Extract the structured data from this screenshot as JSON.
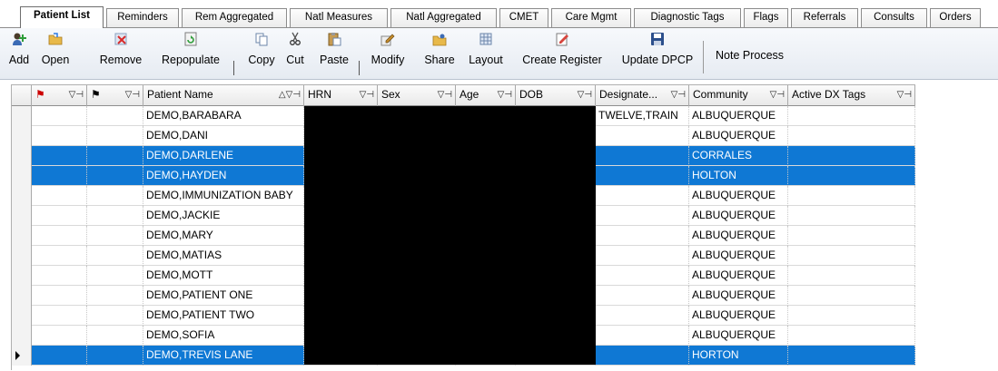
{
  "tabs": [
    {
      "label": "Patient List",
      "active": true
    },
    {
      "label": "Reminders",
      "active": false
    },
    {
      "label": "Rem Aggregated",
      "active": false
    },
    {
      "label": "Natl Measures",
      "active": false
    },
    {
      "label": "Natl Aggregated",
      "active": false
    },
    {
      "label": "CMET",
      "active": false
    },
    {
      "label": "Care Mgmt",
      "active": false
    },
    {
      "label": "Diagnostic Tags",
      "active": false
    },
    {
      "label": "Flags",
      "active": false
    },
    {
      "label": "Referrals",
      "active": false
    },
    {
      "label": "Consults",
      "active": false
    },
    {
      "label": "Orders",
      "active": false
    }
  ],
  "toolbar": {
    "add": "Add",
    "open": "Open",
    "remove": "Remove",
    "repopulate": "Repopulate",
    "copy": "Copy",
    "cut": "Cut",
    "paste": "Paste",
    "modify": "Modify",
    "share": "Share",
    "layout": "Layout",
    "create_register": "Create Register",
    "update_dpcp": "Update DPCP",
    "note_process": "Note Process"
  },
  "grid": {
    "columns": {
      "patient_name": "Patient Name",
      "hrn": "HRN",
      "sex": "Sex",
      "age": "Age",
      "dob": "DOB",
      "designated": "Designate...",
      "community": "Community",
      "active_dx_tags": "Active DX Tags"
    },
    "rows": [
      {
        "name": "DEMO,BARABARA",
        "designated": "TWELVE,TRAIN",
        "community": "ALBUQUERQUE",
        "selected": false
      },
      {
        "name": "DEMO,DANI",
        "designated": "",
        "community": "ALBUQUERQUE",
        "selected": false
      },
      {
        "name": "DEMO,DARLENE",
        "designated": "",
        "community": "CORRALES",
        "selected": true
      },
      {
        "name": "DEMO,HAYDEN",
        "designated": "",
        "community": "HOLTON",
        "selected": true
      },
      {
        "name": "DEMO,IMMUNIZATION BABY",
        "designated": "",
        "community": "ALBUQUERQUE",
        "selected": false
      },
      {
        "name": "DEMO,JACKIE",
        "designated": "",
        "community": "ALBUQUERQUE",
        "selected": false
      },
      {
        "name": "DEMO,MARY",
        "designated": "",
        "community": "ALBUQUERQUE",
        "selected": false
      },
      {
        "name": "DEMO,MATIAS",
        "designated": "",
        "community": "ALBUQUERQUE",
        "selected": false
      },
      {
        "name": "DEMO,MOTT",
        "designated": "",
        "community": "ALBUQUERQUE",
        "selected": false
      },
      {
        "name": "DEMO,PATIENT ONE",
        "designated": "",
        "community": "ALBUQUERQUE",
        "selected": false
      },
      {
        "name": "DEMO,PATIENT TWO",
        "designated": "",
        "community": "ALBUQUERQUE",
        "selected": false
      },
      {
        "name": "DEMO,SOFIA",
        "designated": "",
        "community": "ALBUQUERQUE",
        "selected": false
      },
      {
        "name": "DEMO,TREVIS LANE",
        "designated": "",
        "community": "HORTON",
        "selected": true
      }
    ]
  },
  "colors": {
    "selection": "#0f78d4",
    "redaction": "#000000"
  }
}
